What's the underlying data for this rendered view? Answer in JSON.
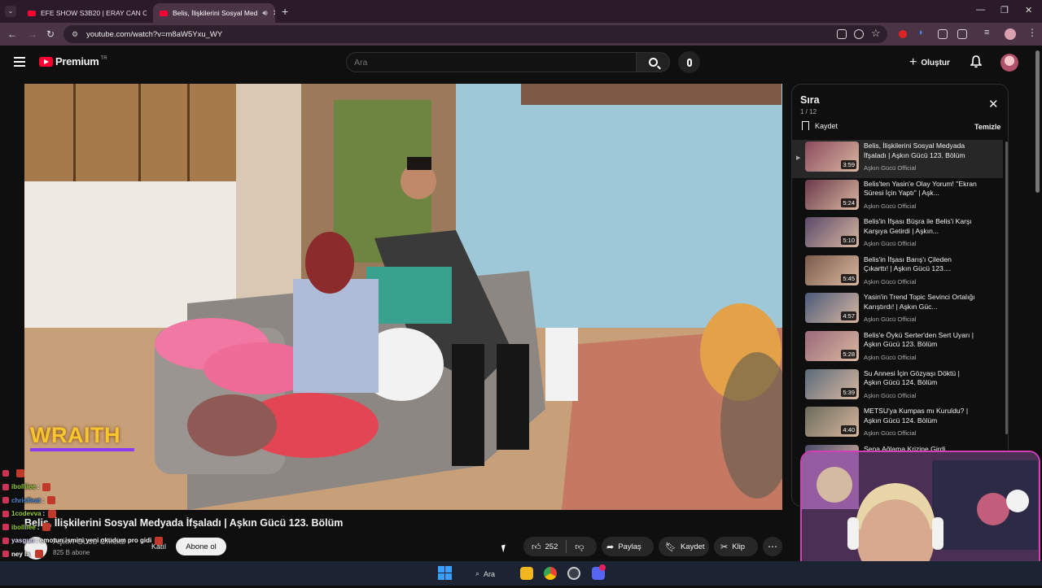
{
  "browser": {
    "tabs": [
      {
        "title": "EFE SHOW S3B20 | ERAY CAN C"
      },
      {
        "title": "Belis, İlişkilerini Sosyal Med"
      }
    ],
    "url": "youtube.com/watch?v=m8aW5Yxu_WY"
  },
  "header": {
    "logo_text": "Premium",
    "region": "TR",
    "search_placeholder": "Ara",
    "create_label": "Oluştur"
  },
  "video": {
    "overlay_logo": "WRAITH",
    "title": "Belis, İlişkilerini Sosyal Medyada İfşaladı | Aşkın Gücü 123. Bölüm",
    "channel": "Aşkın Gücü Official",
    "subscribers": "825 B abone",
    "join_label": "Katıl",
    "subscribe_label": "Abone ol",
    "likes": "252",
    "share_label": "Paylaş",
    "save_label": "Kaydet",
    "clip_label": "Klip"
  },
  "queue": {
    "title": "Sıra",
    "position": "1 / 12",
    "save_label": "Kaydet",
    "clear_label": "Temizle",
    "items": [
      {
        "title": "Belis, İlişkilerini Sosyal Medyada İfşaladı | Aşkın Gücü 123. Bölüm",
        "channel": "Aşkın Gücü Official",
        "duration": "3:59"
      },
      {
        "title": "Belis'ten Yasin'e Olay Yorum! \"Ekran Süresi İçin Yaptı\" | Aşk...",
        "channel": "Aşkın Gücü Official",
        "duration": "5:24"
      },
      {
        "title": "Belis'in İfşası Büşra ile Belis'i Karşı Karşıya Getirdi | Aşkın...",
        "channel": "Aşkın Gücü Official",
        "duration": "5:10"
      },
      {
        "title": "Belis'in İfşası Barış'ı Çileden Çıkarttı! | Aşkın Gücü 123....",
        "channel": "Aşkın Gücü Official",
        "duration": "5:45"
      },
      {
        "title": "Yasin'in Trend Topic Sevinci Ortalığı Karıştırdı! | Aşkın Güc...",
        "channel": "Aşkın Gücü Official",
        "duration": "4:57"
      },
      {
        "title": "Belis'e Öykü Serter'den Sert Uyarı | Aşkın Gücü 123. Bölüm",
        "channel": "Aşkın Gücü Official",
        "duration": "5:28"
      },
      {
        "title": "Su Annesi İçin Gözyaşı Döktü | Aşkın Gücü 124. Bölüm",
        "channel": "Aşkın Gücü Official",
        "duration": "5:39"
      },
      {
        "title": "METSU'ya Kumpas mı Kuruldu? | Aşkın Gücü 124. Bölüm",
        "channel": "Aşkın Gücü Official",
        "duration": "4:40"
      },
      {
        "title": "Sena Ağlama Krizine Girdi",
        "channel": "",
        "duration": ""
      }
    ]
  },
  "chat": [
    {
      "user": "",
      "text": "",
      "color": "#c6c6c6"
    },
    {
      "user": "ibolliiee",
      "text": ":",
      "color": "#9acd32"
    },
    {
      "user": "chrisfleat",
      "text": ":",
      "color": "#4a90e2"
    },
    {
      "user": "1codevva",
      "text": ":",
      "color": "#9acd32"
    },
    {
      "user": "ibolliiee",
      "text": ":",
      "color": "#9acd32"
    },
    {
      "user": "yasgun",
      "text": ": emotun ismini yeni okudum pro gidi",
      "color": "#e0e0ff"
    },
    {
      "user": "ney la",
      "text": "",
      "color": "#ffffff"
    },
    {
      "user": "yasgun",
      "text": ":",
      "color": "#9b59ff"
    },
    {
      "user": "",
      "text": "",
      "color": "#ff4b4b"
    }
  ],
  "taskbar": {
    "search_label": "Ara"
  },
  "colors": {
    "accent": "#ff0033",
    "tab_bar": "#2b1a29",
    "toolbar": "#4a3445",
    "webcam_border": "#d23fb7"
  }
}
